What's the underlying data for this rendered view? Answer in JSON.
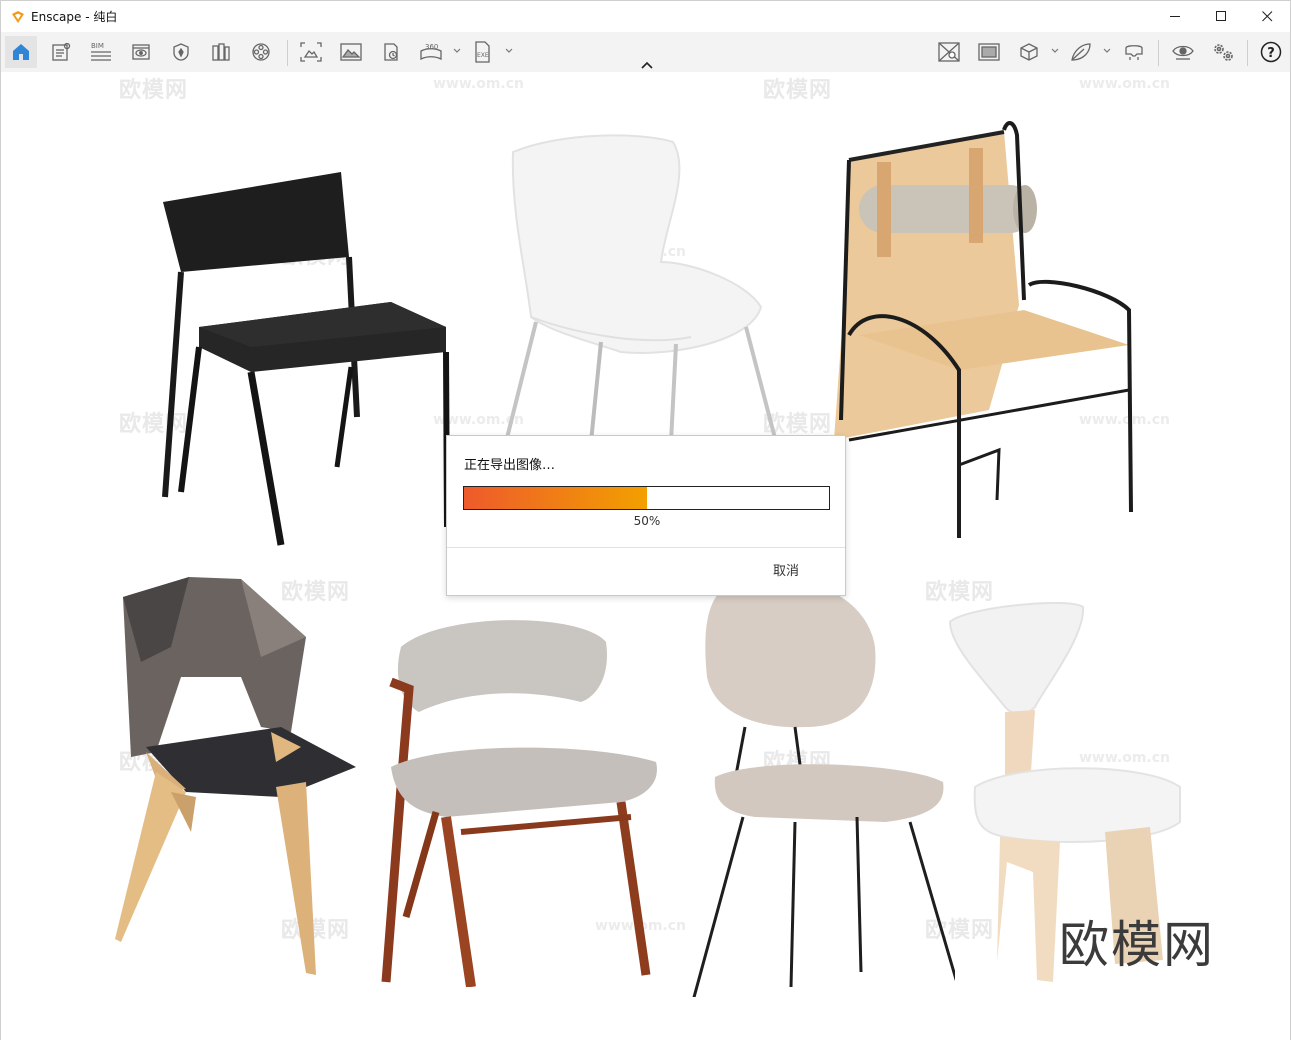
{
  "window": {
    "app_title": "Enscape - 纯白",
    "icons": {
      "app": "enscape-logo-icon",
      "minimize": "minimize-icon",
      "maximize": "maximize-icon",
      "close": "close-icon"
    }
  },
  "toolbar": {
    "bim_label": "BIM",
    "pano_label": "360",
    "exe_label": "EXE",
    "items": [
      "home-icon",
      "view-management-icon",
      "bim-icon",
      "visual-settings-icon",
      "atmosphere-icon",
      "libraries-icon",
      "video-editor-icon",
      "capture-views-icon",
      "screenshot-icon",
      "batch-render-icon",
      "panorama-icon",
      "exe-export-icon",
      "material-editor-icon",
      "safe-frame-icon",
      "orthographic-view-icon",
      "asset-library-icon",
      "vr-headset-icon",
      "visibility-icon",
      "settings-icon",
      "help-icon"
    ]
  },
  "viewport": {
    "watermark_text": "欧模网",
    "watermark_url": "www.om.cn",
    "brand_watermark": "欧模网"
  },
  "dialog": {
    "message": "正在导出图像…",
    "progress_percent": 50,
    "progress_text": "50%",
    "cancel_label": "取消",
    "progress_colors": [
      "#ee5a2b",
      "#f2a000"
    ]
  }
}
